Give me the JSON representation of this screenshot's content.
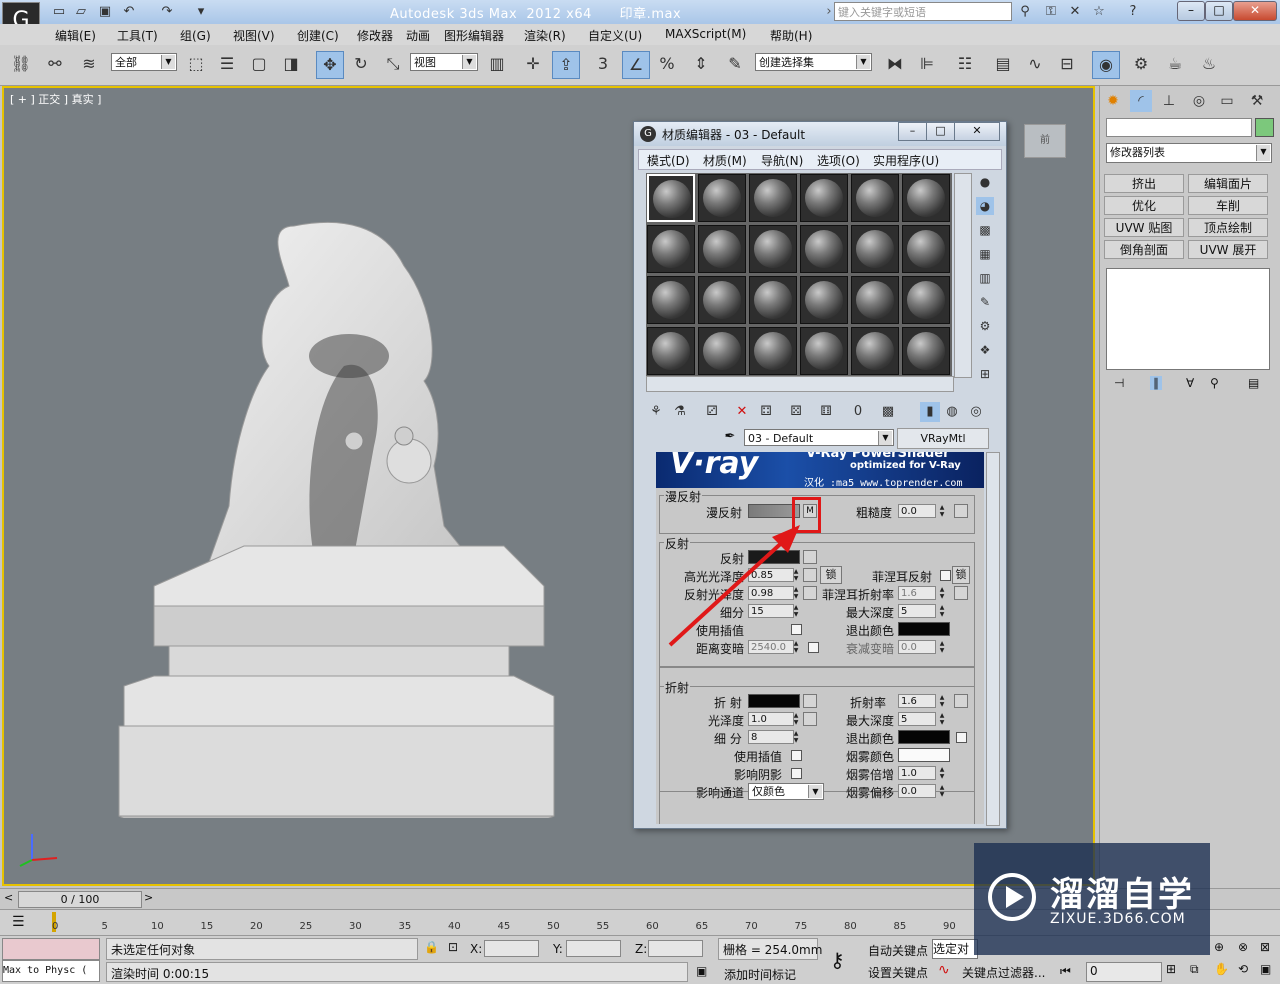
{
  "titlebar": {
    "title": "Autodesk 3ds Max  2012 x64      印章.max",
    "search_placeholder": "键入关键字或短语"
  },
  "menubar": {
    "items": [
      "编辑(E)",
      "工具(T)",
      "组(G)",
      "视图(V)",
      "创建(C)",
      "修改器",
      "动画",
      "图形编辑器",
      "渲染(R)",
      "自定义(U)",
      "MAXScript(M)",
      "帮助(H)"
    ]
  },
  "toolbar": {
    "selection_filter": "全部",
    "reference_coord": "视图",
    "named_selection": "创建选择集"
  },
  "viewport": {
    "label": "[ + ] 正交 ] 真实 ]",
    "viewcube_label": "前"
  },
  "material_editor": {
    "title": "材质编辑器 - 03 - Default",
    "menus": [
      "模式(D)",
      "材质(M)",
      "导航(N)",
      "选项(O)",
      "实用程序(U)"
    ],
    "material_name": "03 - Default",
    "material_type": "VRayMtl",
    "banner": {
      "logo": "V·ray",
      "product": "V-Ray PowerShader",
      "tagline": "optimized for V-Ray",
      "credit": "汉化 :ma5 www.toprender.com"
    },
    "diffuse_group": {
      "title": "漫反射",
      "diffuse_label": "漫反射",
      "map_button": "M",
      "roughness_label": "粗糙度",
      "roughness_value": "0.0"
    },
    "reflection_group": {
      "title": "反射",
      "reflect_label": "反射",
      "hilight_gloss_label": "高光光泽度",
      "hilight_gloss_value": "0.85",
      "lock_label": "锁",
      "fresnel_label": "菲涅耳反射",
      "fresnel_lock": "锁",
      "refl_gloss_label": "反射光泽度",
      "refl_gloss_value": "0.98",
      "fresnel_ior_label": "菲涅耳折射率",
      "fresnel_ior_value": "1.6",
      "subdivs_label": "细分",
      "subdivs_value": "15",
      "max_depth_label": "最大深度",
      "max_depth_value": "5",
      "use_interp_label": "使用插值",
      "exit_color_label": "退出颜色",
      "dim_distance_label": "距离变暗",
      "dim_distance_value": "2540.0",
      "dim_falloff_label": "衰减变暗",
      "dim_falloff_value": "0.0"
    },
    "refraction_group": {
      "title": "折射",
      "refract_label": "折 射",
      "ior_label": "折射率",
      "ior_value": "1.6",
      "gloss_label": "光泽度",
      "gloss_value": "1.0",
      "max_depth_label": "最大深度",
      "max_depth_value": "5",
      "subdivs_label": "细 分",
      "subdivs_value": "8",
      "exit_color_label": "退出颜色",
      "use_interp_label": "使用插值",
      "fog_color_label": "烟雾颜色",
      "affect_shadows_label": "影响阴影",
      "fog_mult_label": "烟雾倍增",
      "fog_mult_value": "1.0",
      "affect_channels_label": "影响通道",
      "affect_channels_value": "仅颜色",
      "fog_bias_label": "烟雾偏移",
      "fog_bias_value": "0.0"
    }
  },
  "command_panel": {
    "modifier_list": "修改器列表",
    "buttons": [
      "挤出",
      "编辑面片",
      "优化",
      "车削",
      "UVW 贴图",
      "顶点绘制",
      "倒角剖面",
      "UVW 展开"
    ]
  },
  "timeline": {
    "slider_label": "0 / 100",
    "ticks": [
      "0",
      "5",
      "10",
      "15",
      "20",
      "25",
      "30",
      "35",
      "40",
      "45",
      "50",
      "55",
      "60",
      "65",
      "70",
      "75",
      "80",
      "85",
      "90"
    ]
  },
  "statusbar": {
    "physx_text": "Max to Physc (",
    "selection_status": "未选定任何对象",
    "render_time": "渲染时间  0:00:15",
    "x_label": "X:",
    "y_label": "Y:",
    "z_label": "Z:",
    "grid": "栅格 = 254.0mm",
    "add_time_tag": "添加时间标记",
    "auto_key": "自动关键点",
    "selected": "选定对",
    "set_key": "设置关键点",
    "key_filters": "关键点过滤器...",
    "frame_value": "0"
  },
  "watermark": {
    "brand": "溜溜自学",
    "url": "ZIXUE.3D66.COM"
  },
  "colors": {
    "viewport_border": "#e6c200",
    "highlight": "#e01818"
  }
}
